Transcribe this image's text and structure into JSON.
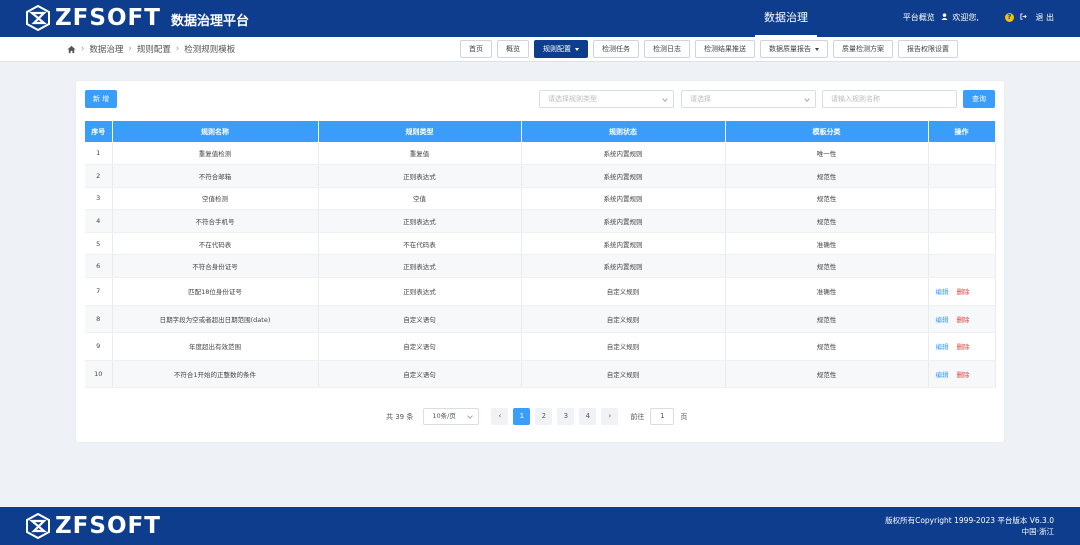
{
  "header": {
    "brand": "ZFSOFT",
    "platform": "数据治理平台",
    "main_nav": "数据治理",
    "overview": "平台概览",
    "welcome": "欢迎您,",
    "logout": "退 出"
  },
  "breadcrumb": [
    "数据治理",
    "规则配置",
    "检测规则模板"
  ],
  "tabs": [
    {
      "label": "首页"
    },
    {
      "label": "概览"
    },
    {
      "label": "规则配置"
    },
    {
      "label": "检测任务"
    },
    {
      "label": "检测日志"
    },
    {
      "label": "检测结果推送"
    },
    {
      "label": "数据质量报告"
    },
    {
      "label": "质量检测方案"
    },
    {
      "label": "报告权限设置"
    }
  ],
  "toolbar": {
    "add_label": "新 增",
    "rule_type_placeholder": "请选择规则类型",
    "select_placeholder": "请选择",
    "name_placeholder": "请输入规则名称",
    "query_label": "查询"
  },
  "table": {
    "headers": [
      "序号",
      "规则名称",
      "规则类型",
      "规则状态",
      "模板分类",
      "操作"
    ],
    "rows": [
      {
        "no": "1",
        "name": "重复值检测",
        "type": "重复值",
        "state": "系统内置规则",
        "category": "唯一性",
        "ops": false
      },
      {
        "no": "2",
        "name": "不符合邮箱",
        "type": "正则表达式",
        "state": "系统内置规则",
        "category": "规范性",
        "ops": false
      },
      {
        "no": "3",
        "name": "空值检测",
        "type": "空值",
        "state": "系统内置规则",
        "category": "规范性",
        "ops": false
      },
      {
        "no": "4",
        "name": "不符合手机号",
        "type": "正则表达式",
        "state": "系统内置规则",
        "category": "规范性",
        "ops": false
      },
      {
        "no": "5",
        "name": "不在代码表",
        "type": "不在代码表",
        "state": "系统内置规则",
        "category": "准确性",
        "ops": false
      },
      {
        "no": "6",
        "name": "不符合身份证号",
        "type": "正则表达式",
        "state": "系统内置规则",
        "category": "规范性",
        "ops": false
      },
      {
        "no": "7",
        "name": "匹配18位身份证号",
        "type": "正则表达式",
        "state": "自定义规则",
        "category": "准确性",
        "ops": true
      },
      {
        "no": "8",
        "name": "日期字段为空或者超出日期范围(date)",
        "type": "自定义语句",
        "state": "自定义规则",
        "category": "规范性",
        "ops": true
      },
      {
        "no": "9",
        "name": "年度超出有效范围",
        "type": "自定义语句",
        "state": "自定义规则",
        "category": "规范性",
        "ops": true
      },
      {
        "no": "10",
        "name": "不符合1开始的正整数的条件",
        "type": "自定义语句",
        "state": "自定义规则",
        "category": "规范性",
        "ops": true
      }
    ],
    "edit_label": "编辑",
    "delete_label": "删除"
  },
  "pagination": {
    "total_text": "共 39 条",
    "page_size": "10条/页",
    "pages": [
      "1",
      "2",
      "3",
      "4"
    ],
    "current_page": "1",
    "prev": "‹",
    "next": "›",
    "goto_label": "前往",
    "goto_value": "1",
    "page_suffix": "页"
  },
  "footer": {
    "brand": "ZFSOFT",
    "copyright": "版权所有Copyright 1999-2023 平台版本 V6.3.0",
    "location": "中国·浙江"
  },
  "colors": {
    "navy": "#0d3d8c",
    "primary": "#3a9dfa",
    "danger": "#e23c3c"
  }
}
